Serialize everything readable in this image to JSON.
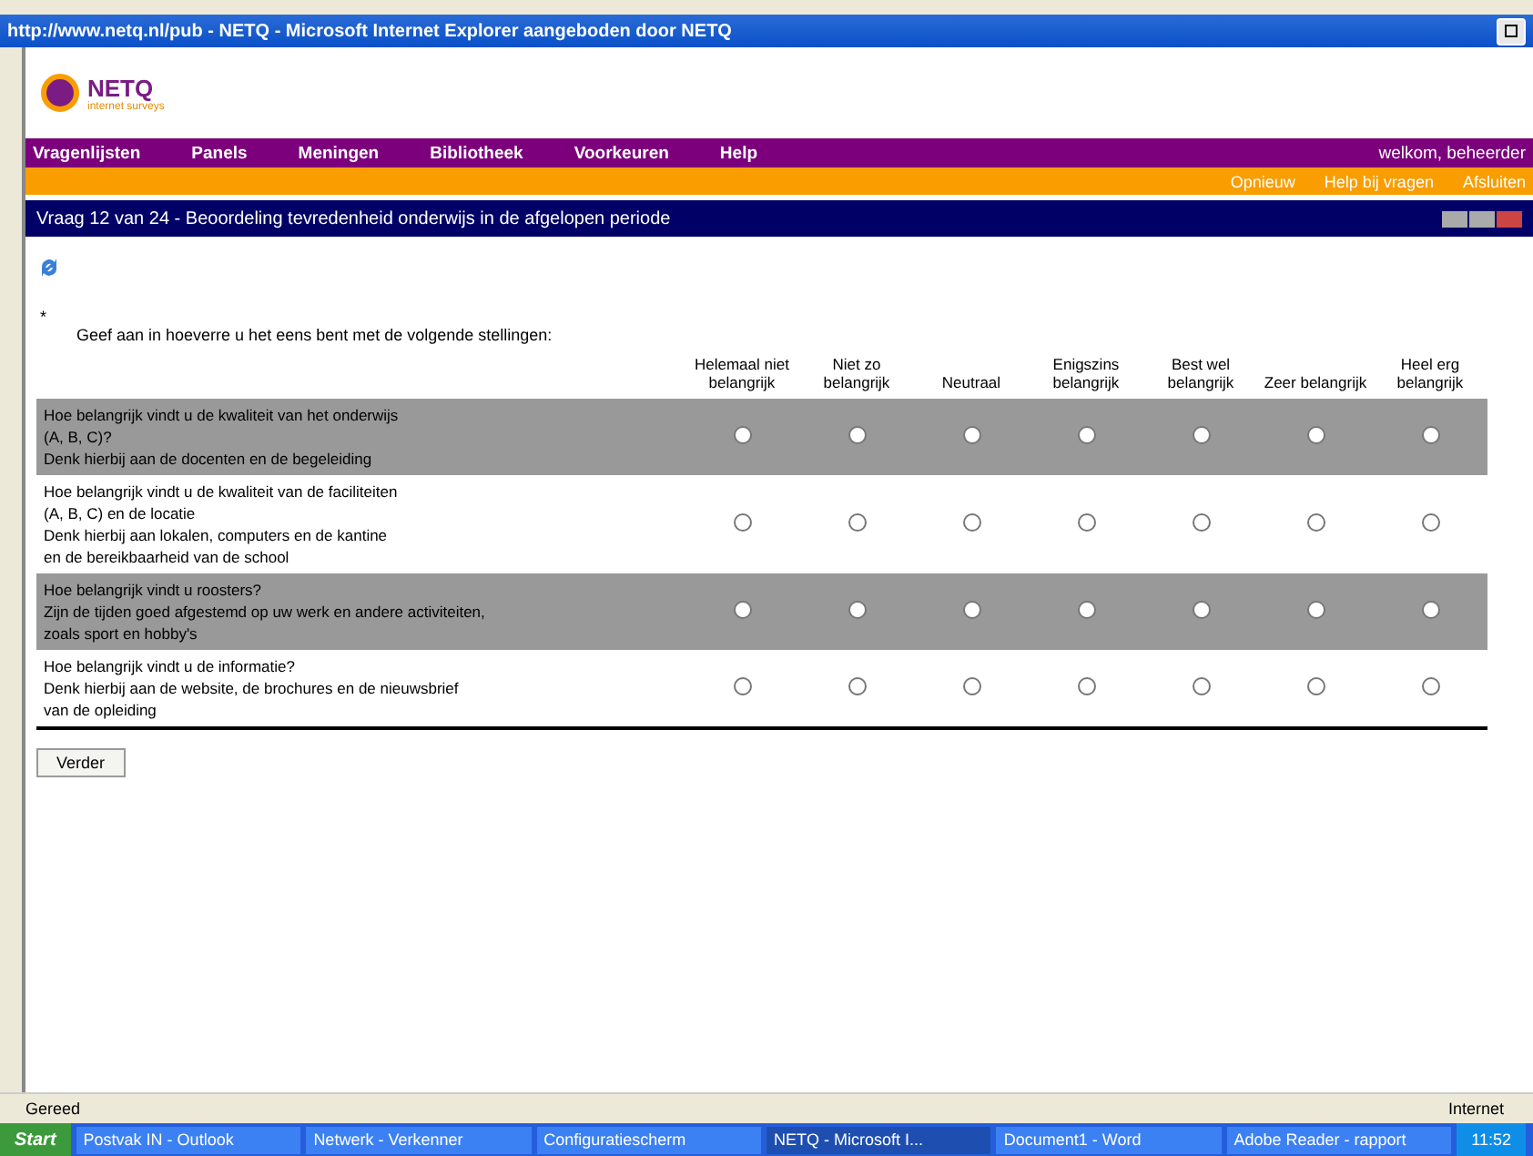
{
  "window": {
    "title": "http://www.netq.nl/pub - NETQ - Microsoft Internet Explorer aangeboden door NETQ"
  },
  "logo": {
    "name": "NETQ",
    "tagline": "internet surveys"
  },
  "menu": {
    "items": [
      "Vragenlijsten",
      "Panels",
      "Meningen",
      "Bibliotheek",
      "Voorkeuren",
      "Help"
    ],
    "user": "welkom, beheerder"
  },
  "sub_links": [
    "Opnieuw",
    "Help bij vragen",
    "Afsluiten"
  ],
  "panel": {
    "title": "Vraag 12 van 24 - Beoordeling tevredenheid onderwijs in de afgelopen periode"
  },
  "note": "*",
  "intro": "Geef aan in hoeverre u het eens bent met de volgende stellingen:",
  "columns": [
    "Helemaal niet belangrijk",
    "Niet zo belangrijk",
    "Neutraal",
    "Enigszins belangrijk",
    "Best wel belangrijk",
    "Zeer belangrijk",
    "Heel erg belangrijk"
  ],
  "questions": [
    {
      "lines": [
        "Hoe belangrijk vindt u de kwaliteit van het onderwijs",
        "(A, B, C)?",
        "Denk hierbij aan de docenten en de begeleiding"
      ],
      "options": [
        {
          "selected": false
        },
        {
          "selected": false
        },
        {
          "selected": false
        },
        {
          "selected": false
        },
        {
          "selected": false
        },
        {
          "selected": false
        },
        {
          "selected": false
        }
      ]
    },
    {
      "lines": [
        "Hoe belangrijk vindt u de kwaliteit van de faciliteiten",
        "(A, B, C) en de locatie",
        "Denk hierbij aan lokalen, computers en de kantine",
        "en de bereikbaarheid van de school"
      ],
      "options": [
        {
          "selected": false
        },
        {
          "selected": false
        },
        {
          "selected": false
        },
        {
          "selected": false
        },
        {
          "selected": false
        },
        {
          "selected": false
        },
        {
          "selected": false
        }
      ]
    },
    {
      "lines": [
        "Hoe belangrijk vindt u roosters?",
        "Zijn de tijden goed afgestemd op uw werk en andere activiteiten,",
        "zoals sport en hobby's"
      ],
      "options": [
        {
          "selected": false
        },
        {
          "selected": false
        },
        {
          "selected": false
        },
        {
          "selected": false
        },
        {
          "selected": false
        },
        {
          "selected": false
        },
        {
          "selected": false
        }
      ]
    },
    {
      "lines": [
        "Hoe belangrijk vindt u de informatie?",
        "Denk hierbij aan de website, de brochures en de nieuwsbrief",
        "van de opleiding"
      ],
      "options": [
        {
          "selected": false
        },
        {
          "selected": false
        },
        {
          "selected": false
        },
        {
          "selected": false
        },
        {
          "selected": false
        },
        {
          "selected": false
        },
        {
          "selected": false
        }
      ]
    }
  ],
  "next_button": "Verder",
  "status_bar": {
    "left": "Gereed",
    "right": "Internet"
  },
  "taskbar": {
    "start": "Start",
    "items": [
      {
        "label": "Postvak IN - Outlook",
        "selected": false
      },
      {
        "label": "Netwerk - Verkenner",
        "selected": false
      },
      {
        "label": "Configuratiescherm",
        "selected": false
      },
      {
        "label": "NETQ - Microsoft I...",
        "selected": true
      },
      {
        "label": "Document1 - Word",
        "selected": false
      },
      {
        "label": "Adobe Reader - rapport",
        "selected": false
      }
    ],
    "clock": "11:52"
  }
}
